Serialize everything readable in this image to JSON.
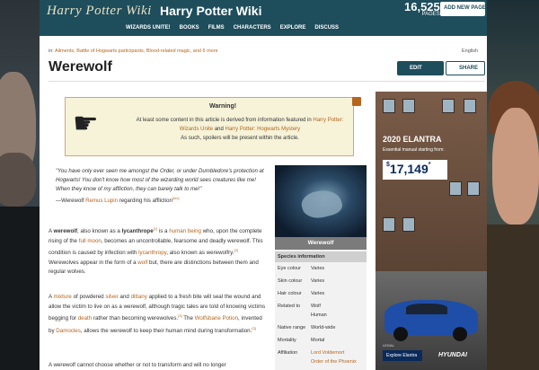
{
  "header": {
    "logo_text": "Harry Potter Wiki",
    "wiki_title": "Harry Potter Wiki",
    "pages_count": "16,525",
    "pages_label": "PAGES",
    "add_page": "ADD NEW PAGE",
    "nav": [
      "WIZARDS UNITE!",
      "BOOKS",
      "FILMS",
      "CHARACTERS",
      "EXPLORE",
      "DISCUSS"
    ]
  },
  "page": {
    "categories_label": "in:",
    "categories": "Ailments, Battle of Hogwarts participants, Blood-related magic, and 6 more",
    "language": "English",
    "title": "Werewolf",
    "edit_label": "EDIT",
    "share_label": "SHARE"
  },
  "warning": {
    "title": "Warning!",
    "line1": "At least some content in this article is derived from information featured in",
    "link1": "Harry Potter: Wizards Unite",
    "and": "and",
    "link2": "Harry Potter: Hogwarts Mystery",
    "line2": "As such, spoilers will be present within the article."
  },
  "quote": {
    "text": "\"You have only ever seen me amongst the Order, or under Dumbledore's protection at Hogwarts! You don't know how most of the wizarding world sees creatures like me! When they know of my affliction, they can barely talk to me!\"",
    "attribution_prefix": "—Werewolf",
    "attribution_link": "Remus Lupin",
    "attribution_suffix": "regarding his affliction",
    "ref": "[src]"
  },
  "paragraphs": {
    "p1_a": "A",
    "p1_bold1": "werewolf",
    "p1_b": ", also known as a",
    "p1_bold2": "lycanthrope",
    "p1_ref1": "[1]",
    "p1_c": "is a",
    "p1_link1": "human being",
    "p1_d": "who, upon the complete rising of the",
    "p1_link2": "full moon",
    "p1_e": ", becomes an uncontrollable, fearsome and deadly werewolf. This condition is caused by infection with",
    "p1_link3": "lycanthropy",
    "p1_f": ", also known as werewolfry.",
    "p1_ref2": "[2]",
    "p1_g": "Werewolves appear in the form of a",
    "p1_link4": "wolf",
    "p1_h": "but, there are distinctions between them and regular wolves.",
    "p2_a": "A",
    "p2_link1": "mixture",
    "p2_b": "of powdered",
    "p2_link2": "silver",
    "p2_c": "and",
    "p2_link3": "dittany",
    "p2_d": "applied to a fresh bite will seal the wound and allow the victim to live on as a werewolf, although tragic tales are told of knowing victims begging for",
    "p2_link4": "death",
    "p2_e": "rather than becoming werewolves.",
    "p2_ref1": "[3]",
    "p2_f": "The",
    "p2_link5": "Wolfsbane Potion",
    "p2_g": ", invented by",
    "p2_link6": "Damocles",
    "p2_h": ", allows the werewolf to keep their human mind during transformation.",
    "p2_ref2": "[3]",
    "p3": "A werewolf cannot choose whether or not to transform and will no longer"
  },
  "infobox": {
    "name": "Werewolf",
    "section": "Species information",
    "rows": [
      {
        "k": "Eye colour",
        "v": "Varies"
      },
      {
        "k": "Skin colour",
        "v": "Varies"
      },
      {
        "k": "Hair colour",
        "v": "Varies"
      },
      {
        "k": "Related to",
        "v": "Wolf"
      },
      {
        "k": "",
        "v": "Human"
      },
      {
        "k": "Native range",
        "v": "World-wide"
      },
      {
        "k": "Mortality",
        "v": "Mortal"
      },
      {
        "k": "Affiliation",
        "v": "Lord Voldemort"
      },
      {
        "k": "",
        "v": "Order of the Phoenix"
      }
    ]
  },
  "ad": {
    "title": "2020 ELANTRA",
    "subtitle": "Essential manual starting from:",
    "price_symbol": "$",
    "price": "17,149",
    "price_sup": "*",
    "legal": "LEGAL",
    "cta": "Explore Elantra",
    "brand": "HYUNDAI"
  }
}
